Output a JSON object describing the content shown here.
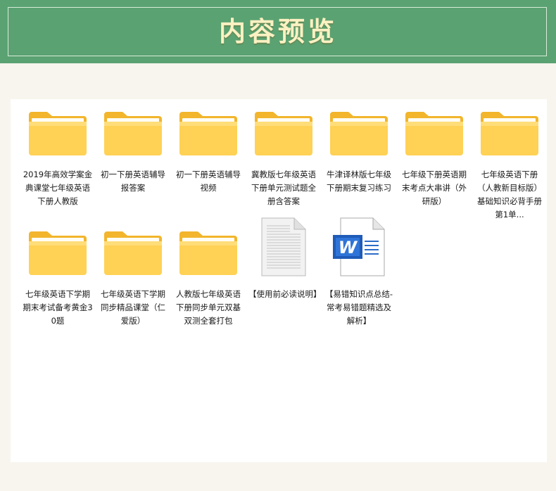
{
  "header": {
    "title": "内容预览"
  },
  "files": [
    {
      "name": "2019年高效学案金典课堂七年级英语下册人教版",
      "icon": "folder-icon"
    },
    {
      "name": "初一下册英语辅导报答案",
      "icon": "folder-icon"
    },
    {
      "name": "初一下册英语辅导视频",
      "icon": "folder-icon"
    },
    {
      "name": "冀教版七年级英语下册单元测试题全册含答案",
      "icon": "folder-icon"
    },
    {
      "name": "牛津译林版七年级下册期末复习练习",
      "icon": "folder-icon"
    },
    {
      "name": "七年级下册英语期末考点大串讲（外研版）",
      "icon": "folder-icon"
    },
    {
      "name": "七年级英语下册（人教新目标版）基础知识必背手册第1单...",
      "icon": "folder-icon"
    },
    {
      "name": "七年级英语下学期期末考试备考黄金30题",
      "icon": "folder-icon"
    },
    {
      "name": "七年级英语下学期同步精品课堂（仁爱版）",
      "icon": "folder-icon"
    },
    {
      "name": "人教版七年级英语下册同步单元双基双测全套打包",
      "icon": "folder-icon"
    },
    {
      "name": "【使用前必读说明】",
      "icon": "text-document-icon"
    },
    {
      "name": "【易错知识点总结-常考易错题精选及解析】",
      "icon": "word-document-icon"
    }
  ],
  "colors": {
    "banner": "#5aa272",
    "title": "#fbf1c2",
    "background": "#f8f5ee",
    "folder": "#ffc83d",
    "word": "#1f5bb8"
  }
}
